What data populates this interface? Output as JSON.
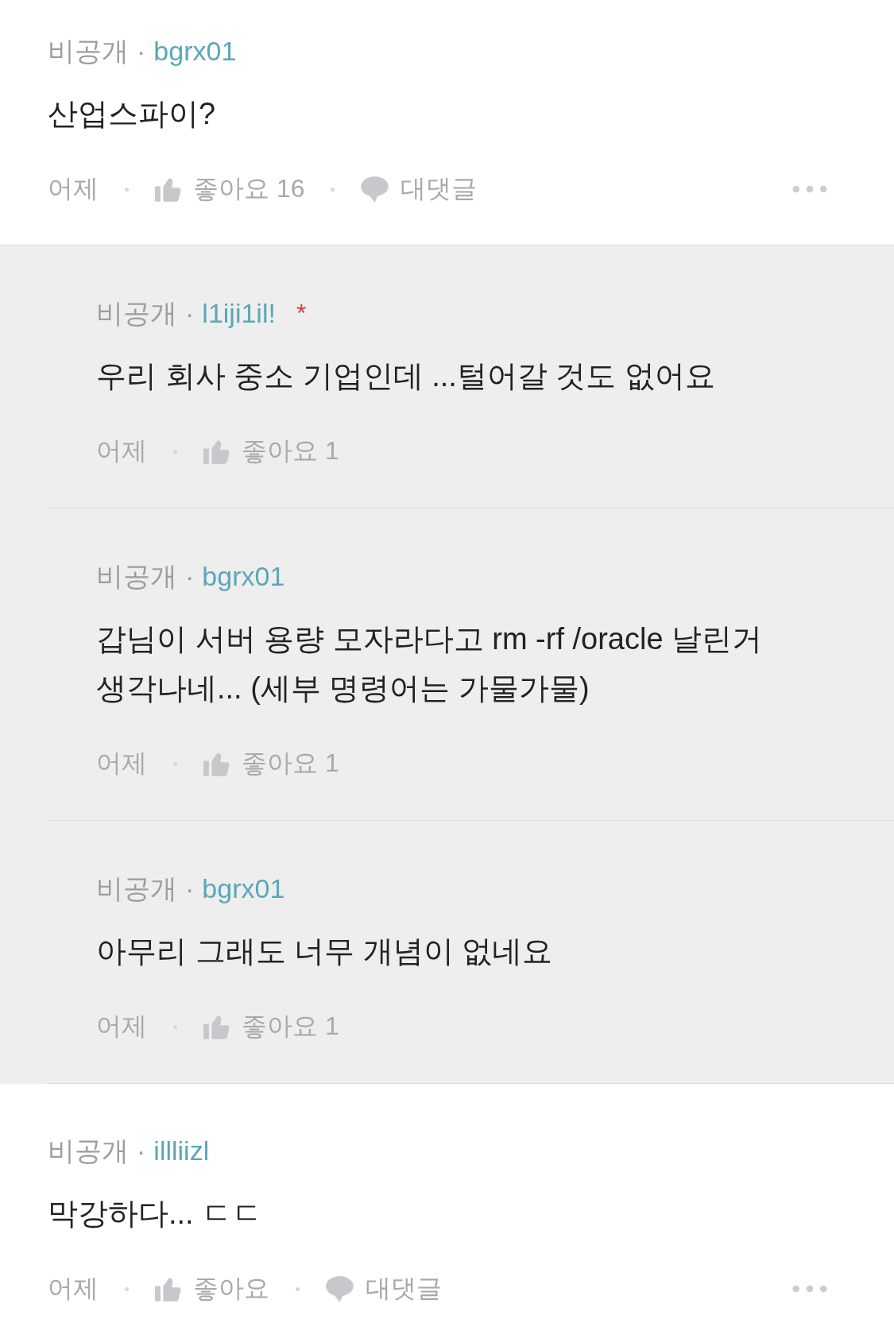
{
  "comments": [
    {
      "visibility": "비공개",
      "separator": "·",
      "author": "bgrx01",
      "text": "산업스파이?",
      "time": "어제",
      "like_label": "좋아요",
      "likes": "16",
      "reply_label": "대댓글",
      "replies": [
        {
          "visibility": "비공개",
          "separator": "·",
          "author": "l1iji1il!",
          "badge": "*",
          "text": "우리 회사 중소 기업인데 ...털어갈 것도 없어요",
          "time": "어제",
          "like_label": "좋아요",
          "likes": "1"
        },
        {
          "visibility": "비공개",
          "separator": "·",
          "author": "bgrx01",
          "text": "갑님이 서버 용량 모자라다고 rm -rf /oracle 날린거 생각나네... (세부 명령어는 가물가물)",
          "time": "어제",
          "like_label": "좋아요",
          "likes": "1"
        },
        {
          "visibility": "비공개",
          "separator": "·",
          "author": "bgrx01",
          "text": "아무리 그래도 너무 개념이 없네요",
          "time": "어제",
          "like_label": "좋아요",
          "likes": "1"
        }
      ]
    },
    {
      "visibility": "비공개",
      "separator": "·",
      "author": "illliizl",
      "text": "막강하다... ㄷㄷ",
      "time": "어제",
      "like_label": "좋아요",
      "reply_label": "대댓글"
    }
  ]
}
